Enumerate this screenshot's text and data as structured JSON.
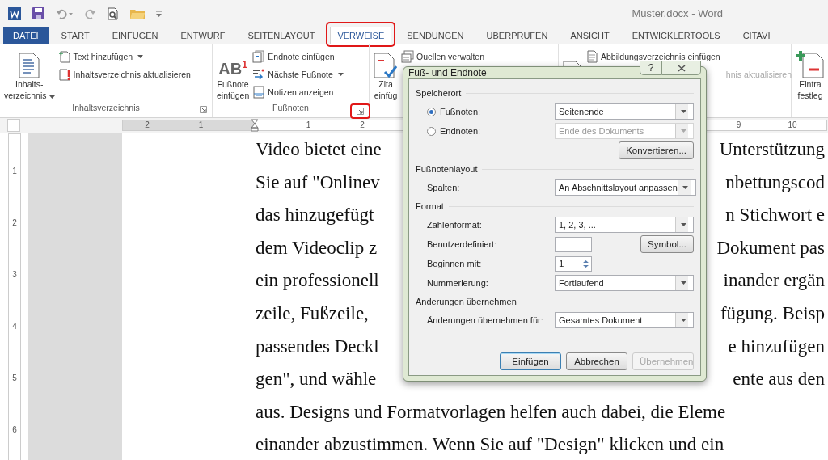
{
  "window": {
    "title": "Muster.docx - Word"
  },
  "tabs": [
    {
      "label": "DATEI",
      "kind": "file",
      "selected": false,
      "highlighted": false
    },
    {
      "label": "START",
      "kind": "tab",
      "selected": false,
      "highlighted": false
    },
    {
      "label": "EINFÜGEN",
      "kind": "tab",
      "selected": false,
      "highlighted": false
    },
    {
      "label": "ENTWURF",
      "kind": "tab",
      "selected": false,
      "highlighted": false
    },
    {
      "label": "SEITENLAYOUT",
      "kind": "tab",
      "selected": false,
      "highlighted": false
    },
    {
      "label": "VERWEISE",
      "kind": "tab",
      "selected": true,
      "highlighted": true
    },
    {
      "label": "SENDUNGEN",
      "kind": "tab",
      "selected": false,
      "highlighted": false
    },
    {
      "label": "ÜBERPRÜFEN",
      "kind": "tab",
      "selected": false,
      "highlighted": false
    },
    {
      "label": "ANSICHT",
      "kind": "tab",
      "selected": false,
      "highlighted": false
    },
    {
      "label": "ENTWICKLERTOOLS",
      "kind": "tab",
      "selected": false,
      "highlighted": false
    },
    {
      "label": "CITAVI",
      "kind": "tab",
      "selected": false,
      "highlighted": false
    }
  ],
  "ribbon": {
    "groups": [
      {
        "label": "Inhaltsverzeichnis",
        "large": {
          "lines": [
            "Inhalts-",
            "verzeichnis"
          ],
          "dropdown": true
        },
        "small": [
          {
            "label": "Text hinzufügen",
            "dropdown": true,
            "disabled": false
          },
          {
            "label": "Inhaltsverzeichnis aktualisieren",
            "disabled": false
          }
        ]
      },
      {
        "label": "Fußnoten",
        "launcher_highlighted": true,
        "large": {
          "glyph": "AB$^{1}$",
          "lines": [
            "Fußnote",
            "einfügen"
          ]
        },
        "small": [
          {
            "label": "Endnote einfügen",
            "disabled": false
          },
          {
            "label": "Nächste Fußnote",
            "dropdown": true,
            "disabled": false
          },
          {
            "label": "Notizen anzeigen",
            "disabled": false
          }
        ]
      },
      {
        "large": {
          "lines": [
            "Zita",
            "einfüg"
          ]
        },
        "small": [
          {
            "label": "Quellen verwalten",
            "disabled": false
          }
        ]
      },
      {
        "small": [
          {
            "label": "Abbildungsverzeichnis einfügen",
            "disabled": false
          },
          {
            "label": "hnis aktualisieren",
            "disabled": true
          }
        ]
      },
      {
        "large": {
          "lines": [
            "Eintra",
            "festleg"
          ]
        }
      }
    ]
  },
  "ruler": {
    "left_numbers": [
      "2",
      "1"
    ],
    "right_numbers": [
      "1",
      "2"
    ],
    "far_numbers": [
      "9",
      "10"
    ]
  },
  "vertical_ruler": {
    "numbers": [
      "1",
      "2",
      "3",
      "4",
      "5",
      "6"
    ]
  },
  "document": {
    "lines": [
      {
        "left": "Video bietet eine",
        "right": "Unterstützung"
      },
      {
        "left": "Sie auf \"Onlinev",
        "right": "nbettungscod"
      },
      {
        "left": "das hinzugefügt",
        "right": "n Stichwort e"
      },
      {
        "left": "dem Videoclip z",
        "right": "Dokument pas"
      },
      {
        "left": "ein professionell",
        "right": "inander ergän"
      },
      {
        "left": "zeile, Fußzeile,",
        "right": "fügung. Beisp"
      },
      {
        "left": "passendes Deckl",
        "right": "e hinzufügen"
      },
      {
        "left": "gen\", und wähle",
        "right": "ente aus den"
      },
      {
        "left": "aus. Designs und Formatvorlagen helfen auch dabei, die Eleme"
      },
      {
        "left": "einander abzustimmen. Wenn Sie auf \"Design\" klicken und ein"
      }
    ]
  },
  "dialog": {
    "title": "Fuß- und Endnote",
    "help": "?",
    "sections": [
      {
        "title": "Speicherort",
        "rows": [
          {
            "kind": "radio",
            "label": "Fußnoten:",
            "selected": true,
            "value": "Seitenende",
            "disabled": false
          },
          {
            "kind": "radio",
            "label": "Endnoten:",
            "selected": false,
            "value": "Ende des Dokuments",
            "disabled": true
          },
          {
            "kind": "button",
            "label": "Konvertieren..."
          }
        ]
      },
      {
        "title": "Fußnotenlayout",
        "rows": [
          {
            "kind": "select",
            "label": "Spalten:",
            "value": "An Abschnittslayout anpassen",
            "disabled": false
          }
        ]
      },
      {
        "title": "Format",
        "rows": [
          {
            "kind": "select",
            "label": "Zahlenformat:",
            "value": "1, 2, 3, ...",
            "disabled": false
          },
          {
            "kind": "text",
            "label": "Benutzerdefiniert:",
            "button": "Symbol..."
          },
          {
            "kind": "spin",
            "label": "Beginnen mit:",
            "value": "1"
          },
          {
            "kind": "select",
            "label": "Nummerierung:",
            "value": "Fortlaufend",
            "disabled": false
          }
        ]
      },
      {
        "title": "Änderungen übernehmen",
        "rows": [
          {
            "kind": "select",
            "label": "Änderungen übernehmen für:",
            "value": "Gesamtes Dokument",
            "disabled": false
          }
        ]
      }
    ],
    "buttons": [
      {
        "label": "Einfügen",
        "default": true,
        "disabled": false
      },
      {
        "label": "Abbrechen",
        "default": false,
        "disabled": false
      },
      {
        "label": "Übernehmen",
        "default": false,
        "disabled": true
      }
    ]
  }
}
